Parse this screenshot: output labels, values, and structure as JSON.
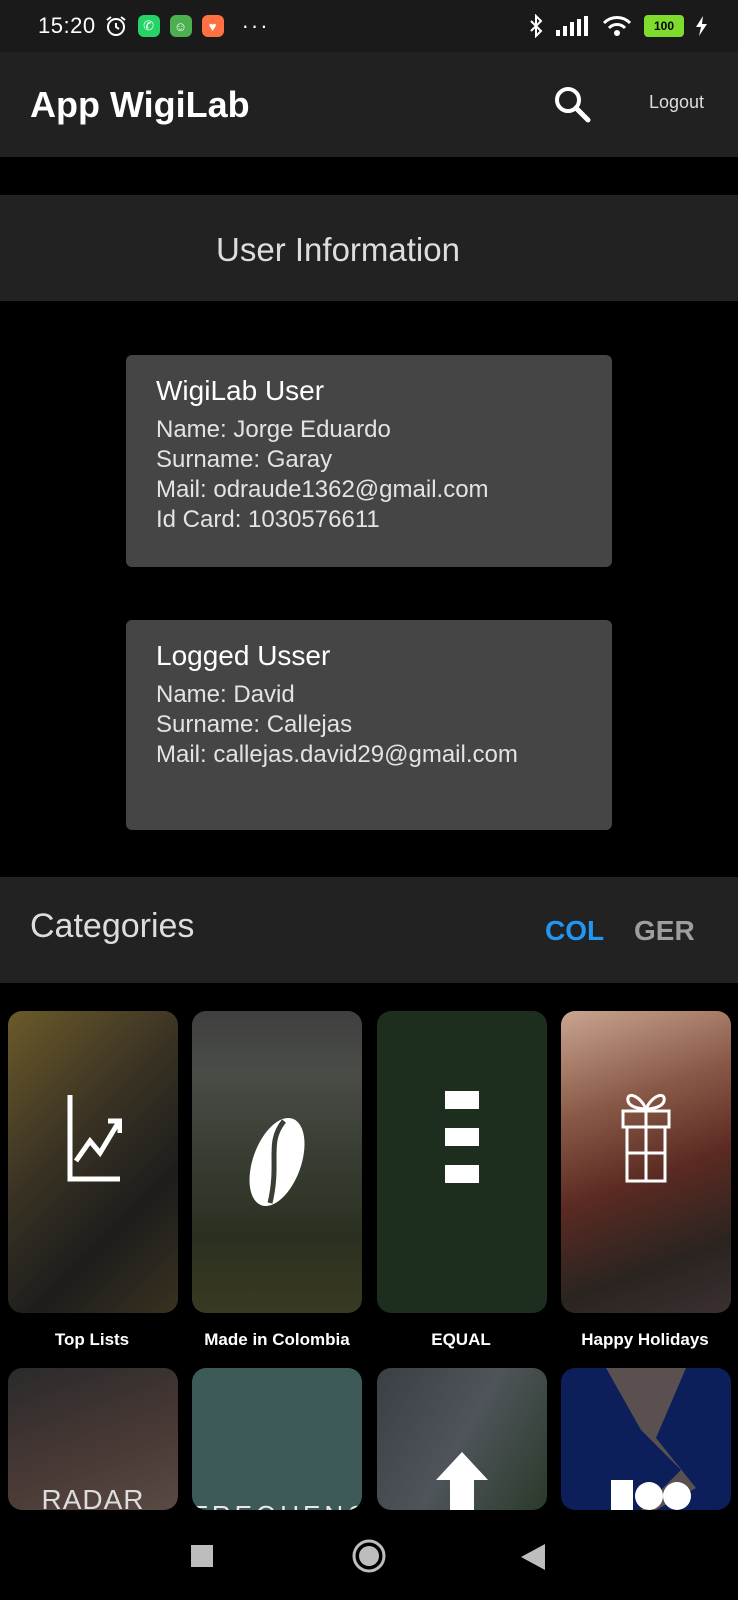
{
  "status_bar": {
    "time": "15:20",
    "battery": "100"
  },
  "app_bar": {
    "title": "App WigiLab",
    "logout_label": "Logout"
  },
  "user_info": {
    "title": "User Information"
  },
  "cards": [
    {
      "title": "WigiLab User",
      "lines": [
        "Name: Jorge Eduardo",
        "Surname: Garay",
        "Mail: odraude1362@gmail.com",
        "Id Card: 1030576611"
      ]
    },
    {
      "title": "Logged Usser",
      "lines": [
        "Name: David",
        "Surname: Callejas",
        "Mail: callejas.david29@gmail.com"
      ]
    }
  ],
  "categories": {
    "title": "Categories",
    "languages": [
      {
        "label": "COL",
        "active": true,
        "color": "#2196f3"
      },
      {
        "label": "GER",
        "active": false,
        "color": "#9e9e9e"
      }
    ],
    "tiles": [
      {
        "label": "Top Lists",
        "icon": "chart-trend-icon"
      },
      {
        "label": "Made in Colombia",
        "icon": "coffee-bean-icon"
      },
      {
        "label": "EQUAL",
        "icon": "equal-bars-icon"
      },
      {
        "label": "Happy Holidays",
        "icon": "gift-icon"
      }
    ],
    "row2_tiles": [
      {
        "text": "RADAR"
      },
      {
        "text": "FREQUENCY"
      },
      {
        "text": ""
      },
      {
        "text": ""
      }
    ]
  },
  "colors": {
    "accent": "#2196f3",
    "card_bg": "#454545",
    "header_bg": "#212121"
  }
}
